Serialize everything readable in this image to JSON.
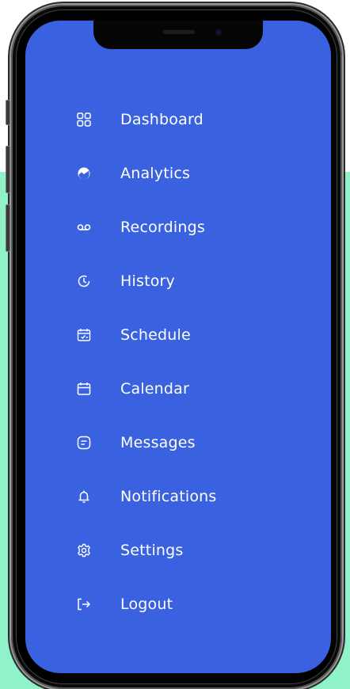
{
  "menu": {
    "items": [
      {
        "label": "Dashboard",
        "icon": "grid-icon"
      },
      {
        "label": "Analytics",
        "icon": "chart-icon"
      },
      {
        "label": "Recordings",
        "icon": "voicemail-icon"
      },
      {
        "label": "History",
        "icon": "clock-icon"
      },
      {
        "label": "Schedule",
        "icon": "schedule-icon"
      },
      {
        "label": "Calendar",
        "icon": "calendar-icon"
      },
      {
        "label": "Messages",
        "icon": "message-icon"
      },
      {
        "label": "Notifications",
        "icon": "bell-icon"
      },
      {
        "label": "Settings",
        "icon": "gear-icon"
      },
      {
        "label": "Logout",
        "icon": "logout-icon"
      }
    ]
  },
  "colors": {
    "screen_bg": "#3a62e0",
    "backdrop": "#8ff2c8",
    "text": "#ffffff"
  }
}
